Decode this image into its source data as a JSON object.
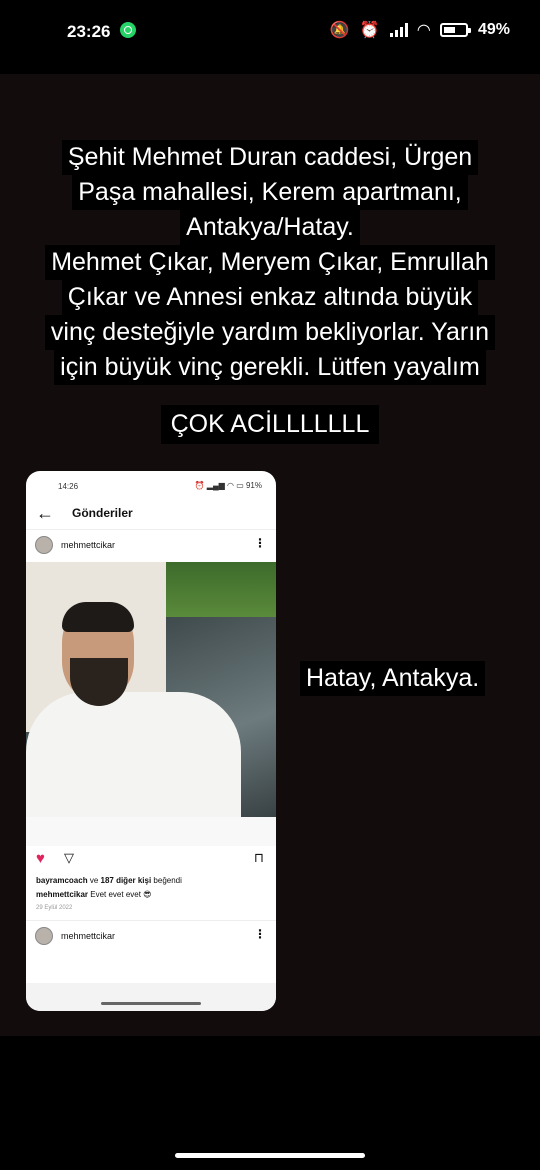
{
  "status_bar": {
    "time": "23:26",
    "battery": "49%",
    "icons": [
      "whatsapp-icon",
      "mute-icon",
      "alarm-icon",
      "signal-icon",
      "wifi-icon",
      "battery-icon"
    ]
  },
  "story": {
    "caption_lines": [
      "Şehit Mehmet Duran caddesi, Ürgen",
      "Paşa mahallesi, Kerem apartmanı,",
      "Antakya/Hatay.",
      "Mehmet Çıkar, Meryem Çıkar, Emrullah",
      "Çıkar ve Annesi enkaz altında büyük",
      "vinç desteğiyle yardım bekliyorlar. Yarın",
      "için büyük vinç gerekli. Lütfen yayalım"
    ],
    "urgent": "ÇOK ACİLLLLLLL",
    "side_label": "Hatay, Antakya."
  },
  "embedded": {
    "time": "14:26",
    "status_right": "91%",
    "header_title": "Gönderiler",
    "username": "mehmettcikar",
    "likes_user": "bayramcoach",
    "likes_mid": " ve ",
    "likes_count": "187 diğer kişi",
    "likes_suffix": " beğendi",
    "caption_user": "mehmettcikar",
    "caption_text": " Evet evet evet 😎",
    "date": "29 Eylül 2022",
    "next_username": "mehmettcikar"
  },
  "colors": {
    "background": "#000000",
    "story_bg": "#120c0c",
    "heart": "#e0245e",
    "whatsapp": "#25d366"
  }
}
